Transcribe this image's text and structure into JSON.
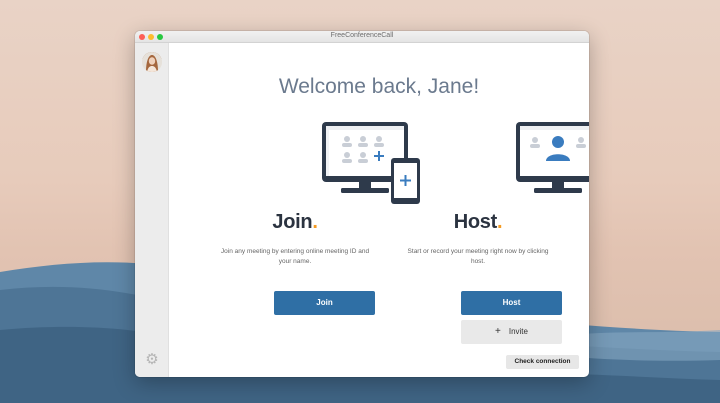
{
  "window": {
    "title": "FreeConferenceCall"
  },
  "sidebar": {
    "avatar_icon": "user-avatar",
    "settings_icon": "gear-icon"
  },
  "main": {
    "welcome": "Welcome back, Jane!",
    "join": {
      "title": "Join",
      "dot": ".",
      "description": "Join any meeting by entering online meeting ID and your name.",
      "button_label": "Join"
    },
    "host": {
      "title": "Host",
      "dot": ".",
      "description": "Start or record your meeting right now by clicking host.",
      "button_label": "Host",
      "invite_label": "Invite",
      "invite_icon": "plus-icon"
    },
    "check_connection_label": "Check connection"
  },
  "colors": {
    "accent": "#2f6fa5",
    "dot_orange": "#f59b23",
    "illustration_dark": "#2e3a4b",
    "illustration_blue": "#3a7cbf"
  }
}
